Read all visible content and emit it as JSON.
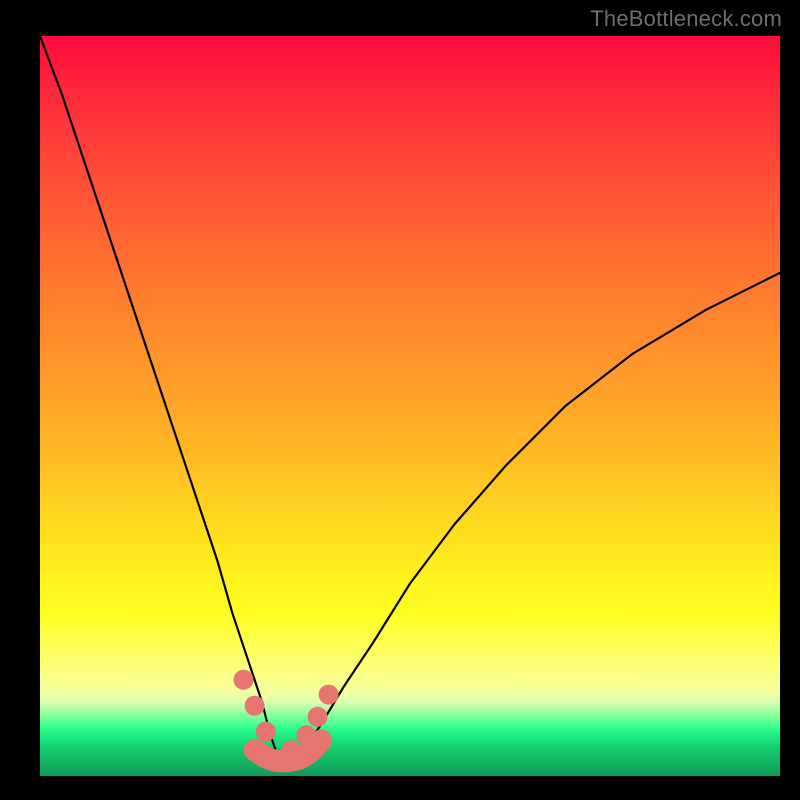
{
  "watermark": "TheBottleneck.com",
  "colors": {
    "frame": "#000000",
    "gradient_top": "#ff0a3c",
    "gradient_mid": "#ffe81d",
    "gradient_bottom": "#109a56",
    "curve": "#000000",
    "marker": "#e7746f"
  },
  "chart_data": {
    "type": "line",
    "title": "",
    "xlabel": "",
    "ylabel": "",
    "xlim": [
      0,
      100
    ],
    "ylim": [
      0,
      100
    ],
    "notes": "V-shaped bottleneck curve over red→green gradient. Minimum near x≈33. Pink markers and thick pink segment highlight the low-bottleneck region around the trough. No axis ticks or numeric labels are rendered.",
    "series": [
      {
        "name": "bottleneck-curve",
        "x": [
          0,
          3,
          6,
          9,
          12,
          15,
          18,
          21,
          24,
          26,
          28,
          30,
          31,
          32,
          33,
          34,
          35,
          36,
          38,
          41,
          45,
          50,
          56,
          63,
          71,
          80,
          90,
          100
        ],
        "values": [
          100,
          92,
          83,
          74,
          65,
          56,
          47,
          38,
          29,
          22,
          16,
          10,
          6,
          3,
          2,
          2,
          3,
          4,
          7,
          12,
          18,
          26,
          34,
          42,
          50,
          57,
          63,
          68
        ]
      }
    ],
    "markers": {
      "name": "highlight-points",
      "x": [
        27.5,
        29.0,
        30.5,
        34.0,
        36.0,
        37.5,
        39.0
      ],
      "values": [
        13.0,
        9.5,
        6.0,
        3.5,
        5.5,
        8.0,
        11.0
      ]
    },
    "bottom_segment": {
      "name": "highlight-segment",
      "x": [
        29.0,
        30.5,
        32.0,
        33.5,
        35.0,
        36.5,
        38.0
      ],
      "values": [
        3.5,
        2.5,
        2.0,
        2.0,
        2.3,
        3.2,
        4.8
      ]
    }
  }
}
